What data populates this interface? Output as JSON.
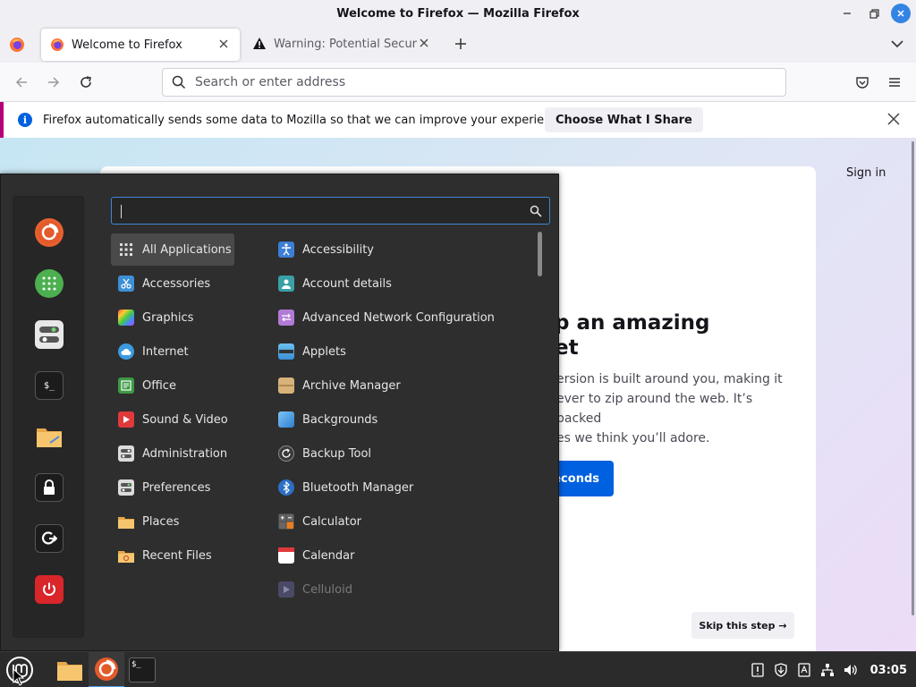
{
  "window": {
    "title": "Welcome to Firefox — Mozilla Firefox"
  },
  "tabs": [
    {
      "label": "Welcome to Firefox",
      "active": true
    },
    {
      "label": "Warning: Potential Security Risk Ahead",
      "active": false
    }
  ],
  "urlbar": {
    "placeholder": "Search or enter address",
    "value": ""
  },
  "notification": {
    "text": "Firefox automatically sends some data to Mozilla so that we can improve your experience.",
    "button": "Choose What I Share"
  },
  "page": {
    "sign_in": "Sign in",
    "headline_line1": "p an amazing",
    "headline_line2": "et",
    "desc_line1": "ersion is built around you, making it",
    "desc_line2": "ever to zip around the web. It’s packed",
    "desc_line3": "es we think you’ll adore.",
    "primary_button": "econds",
    "skip_button": "Skip this step →"
  },
  "menu": {
    "search_value": "",
    "favorites": [
      {
        "name": "firefox",
        "color": "#e9602f"
      },
      {
        "name": "calculator-green",
        "color": "#4caf50"
      },
      {
        "name": "settings-toggles",
        "color": "#e0e0e0"
      },
      {
        "name": "terminal",
        "color": "#1c1c1c"
      },
      {
        "name": "files",
        "color": "#f5c26b"
      },
      {
        "name": "lock-screen",
        "color": "#1c1c1c"
      },
      {
        "name": "logout",
        "color": "#1c1c1c"
      },
      {
        "name": "power",
        "color": "#d9262b"
      }
    ],
    "categories": [
      {
        "label": "All Applications",
        "icon": "grid-icon",
        "color": "#4a4a4a"
      },
      {
        "label": "Accessories",
        "icon": "scissors-icon",
        "color": "#3d8fd6"
      },
      {
        "label": "Graphics",
        "icon": "palette-icon",
        "color": "#c84cd6"
      },
      {
        "label": "Internet",
        "icon": "cloud-icon",
        "color": "#3a9be0"
      },
      {
        "label": "Office",
        "icon": "office-icon",
        "color": "#3d9a45"
      },
      {
        "label": "Sound & Video",
        "icon": "play-icon",
        "color": "#e0393c"
      },
      {
        "label": "Administration",
        "icon": "toggles-icon",
        "color": "#dcdcdc"
      },
      {
        "label": "Preferences",
        "icon": "prefs-icon",
        "color": "#dcdcdc"
      },
      {
        "label": "Places",
        "icon": "folder-icon",
        "color": "#f2b24f"
      },
      {
        "label": "Recent Files",
        "icon": "recent-folder-icon",
        "color": "#f2b24f"
      }
    ],
    "apps": [
      {
        "label": "Accessibility",
        "icon": "accessibility-icon",
        "color": "#3d7ed6",
        "dim": false
      },
      {
        "label": "Account details",
        "icon": "account-icon",
        "color": "#3aa0a6",
        "dim": false
      },
      {
        "label": "Advanced Network Configuration",
        "icon": "network-icon",
        "color": "#b27ad6",
        "dim": false
      },
      {
        "label": "Applets",
        "icon": "applets-icon",
        "color": "#5ab0e8",
        "dim": false
      },
      {
        "label": "Archive Manager",
        "icon": "archive-icon",
        "color": "#d7b27a",
        "dim": false
      },
      {
        "label": "Backgrounds",
        "icon": "backgrounds-icon",
        "color": "#5aa8e8",
        "dim": false
      },
      {
        "label": "Backup Tool",
        "icon": "backup-icon",
        "color": "#3a3a3a",
        "dim": false
      },
      {
        "label": "Bluetooth Manager",
        "icon": "bluetooth-icon",
        "color": "#2d6fc4",
        "dim": false
      },
      {
        "label": "Calculator",
        "icon": "calculator-icon",
        "color": "#4a4a4a",
        "dim": false
      },
      {
        "label": "Calendar",
        "icon": "calendar-icon",
        "color": "#ffffff",
        "dim": false
      },
      {
        "label": "Celluloid",
        "icon": "celluloid-icon",
        "color": "#5b5b7a",
        "dim": true
      }
    ]
  },
  "taskbar": {
    "clock": "03:05"
  }
}
